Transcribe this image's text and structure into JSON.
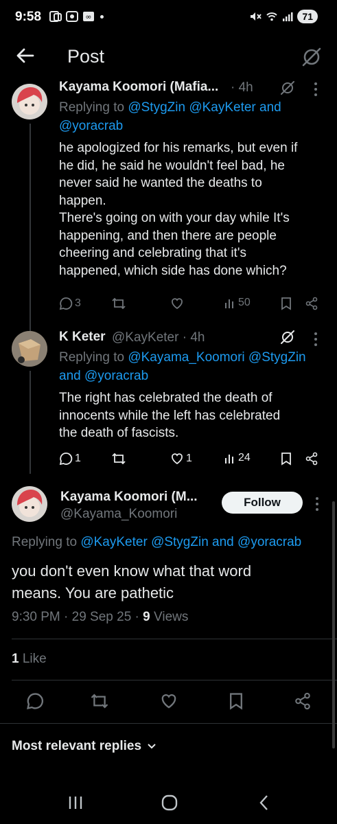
{
  "status": {
    "time": "9:58",
    "battery": "71"
  },
  "header": {
    "title": "Post"
  },
  "replies": [
    {
      "name": "Kayama Koomori (Mafia...",
      "time": "· 4h",
      "replying_prefix": "Replying to",
      "replying_line1": "@StygZin @KayKeter and",
      "replying_line2": "@yoracrab",
      "lines": [
        "he apologized for his remarks, but even if",
        "he did, he said he wouldn't feel bad, he",
        "never said he wanted the deaths to",
        "happen.",
        "There's going on with your day while It's",
        "happening, and then there are people",
        "cheering and celebrating that it's",
        "happened, which side has done which?"
      ],
      "reply_count": "3",
      "retweet_count": "",
      "like_count": "",
      "views": "50"
    },
    {
      "name": "K Keter",
      "handle": "@KayKeter · 4h",
      "replying_prefix": "Replying to",
      "replying_line1": "@Kayama_Koomori @StygZin",
      "replying_and": "and",
      "replying_line2": "@yoracrab",
      "lines": [
        "The right has celebrated the death of",
        "innocents while the left has celebrated",
        "the death of fascists."
      ],
      "reply_count": "1",
      "retweet_count": "",
      "like_count": "1",
      "views": "24"
    }
  ],
  "main": {
    "name": "Kayama Koomori (M...",
    "handle": "@Kayama_Koomori",
    "follow_label": "Follow",
    "replying_prefix": "Replying to",
    "replying_mentions": "@KayKeter @StygZin",
    "replying_and": "and",
    "replying_last": "@yoracrab",
    "text_line1": "you don't even know what that word",
    "text_line2": "means.  You are pathetic",
    "timestamp": "9:30 PM · 29 Sep 25 ·",
    "views_count": "9",
    "views_label": "Views",
    "likes_count": "1",
    "likes_label": "Like"
  },
  "sort": {
    "label": "Most relevant replies"
  },
  "colors": {
    "accent": "#1d9bf0",
    "muted": "#71767b",
    "background": "#000000"
  }
}
